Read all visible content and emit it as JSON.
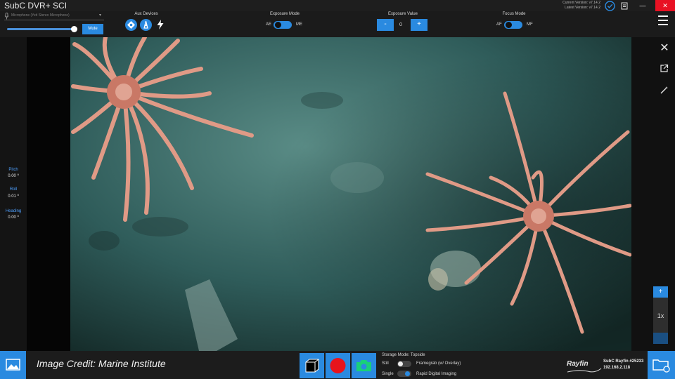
{
  "app": {
    "title": "SubC DVR+ SCI",
    "current_version": "Current Version: v7.14.2",
    "latest_version": "Latest Version: v7.14.2"
  },
  "audio": {
    "mic_placeholder": "Microphone (Yeti Stereo Microphone)",
    "mute_label": "Mute",
    "volume_level": 0.95
  },
  "aux": {
    "label": "Aux Devices"
  },
  "exposure_mode": {
    "label": "Exposure Mode",
    "left": "AE",
    "right": "ME",
    "value": "AE"
  },
  "exposure_value": {
    "label": "Exposure Value",
    "minus": "-",
    "value": "0",
    "plus": "+"
  },
  "focus_mode": {
    "label": "Focus Mode",
    "left": "AF",
    "right": "MF",
    "value": "AF"
  },
  "sensors": [
    {
      "label": "Pitch",
      "value": "0.00 º"
    },
    {
      "label": "Roll",
      "value": "0.01 º"
    },
    {
      "label": "Heading",
      "value": "0.00 º"
    }
  ],
  "zoom": {
    "plus": "+",
    "level": "1x"
  },
  "bottom": {
    "credit": "Image Credit: Marine Institute",
    "storage_mode": "Storage Mode: Topside",
    "still": "Still",
    "framegrab": "Framegrab (w/ Overlay)",
    "single": "Single",
    "rapid": "Rapid Digital Imaging",
    "logo": "Rayfin",
    "device_name": "SubC Rayfin #25233",
    "device_ip": "192.168.2.118"
  },
  "colors": {
    "accent": "#2a8ae0",
    "record": "#e8141c",
    "camera_icon": "#19d07a"
  }
}
